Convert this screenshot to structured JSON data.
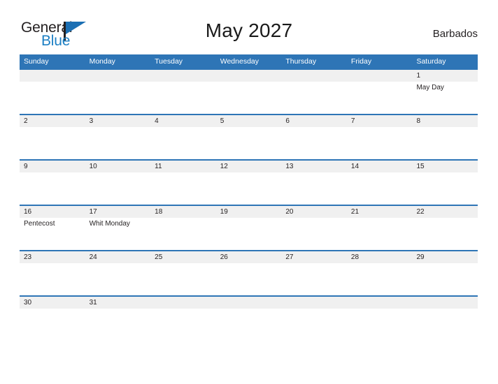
{
  "brand": {
    "word_one": "General",
    "word_two": "Blue",
    "accent_color": "#1b6fb3",
    "flag_icon": "flag-triangle-icon"
  },
  "header": {
    "title": "May 2027",
    "country": "Barbados"
  },
  "theme": {
    "header_blue": "#2e75b6",
    "row_band_gray": "#f0f0f0",
    "text_color": "#231f20"
  },
  "calendar": {
    "day_names": [
      "Sunday",
      "Monday",
      "Tuesday",
      "Wednesday",
      "Thursday",
      "Friday",
      "Saturday"
    ],
    "weeks": [
      [
        {
          "day": "",
          "event": ""
        },
        {
          "day": "",
          "event": ""
        },
        {
          "day": "",
          "event": ""
        },
        {
          "day": "",
          "event": ""
        },
        {
          "day": "",
          "event": ""
        },
        {
          "day": "",
          "event": ""
        },
        {
          "day": "1",
          "event": "May Day"
        }
      ],
      [
        {
          "day": "2",
          "event": ""
        },
        {
          "day": "3",
          "event": ""
        },
        {
          "day": "4",
          "event": ""
        },
        {
          "day": "5",
          "event": ""
        },
        {
          "day": "6",
          "event": ""
        },
        {
          "day": "7",
          "event": ""
        },
        {
          "day": "8",
          "event": ""
        }
      ],
      [
        {
          "day": "9",
          "event": ""
        },
        {
          "day": "10",
          "event": ""
        },
        {
          "day": "11",
          "event": ""
        },
        {
          "day": "12",
          "event": ""
        },
        {
          "day": "13",
          "event": ""
        },
        {
          "day": "14",
          "event": ""
        },
        {
          "day": "15",
          "event": ""
        }
      ],
      [
        {
          "day": "16",
          "event": "Pentecost"
        },
        {
          "day": "17",
          "event": "Whit Monday"
        },
        {
          "day": "18",
          "event": ""
        },
        {
          "day": "19",
          "event": ""
        },
        {
          "day": "20",
          "event": ""
        },
        {
          "day": "21",
          "event": ""
        },
        {
          "day": "22",
          "event": ""
        }
      ],
      [
        {
          "day": "23",
          "event": ""
        },
        {
          "day": "24",
          "event": ""
        },
        {
          "day": "25",
          "event": ""
        },
        {
          "day": "26",
          "event": ""
        },
        {
          "day": "27",
          "event": ""
        },
        {
          "day": "28",
          "event": ""
        },
        {
          "day": "29",
          "event": ""
        }
      ],
      [
        {
          "day": "30",
          "event": ""
        },
        {
          "day": "31",
          "event": ""
        },
        {
          "day": "",
          "event": ""
        },
        {
          "day": "",
          "event": ""
        },
        {
          "day": "",
          "event": ""
        },
        {
          "day": "",
          "event": ""
        },
        {
          "day": "",
          "event": ""
        }
      ]
    ]
  }
}
